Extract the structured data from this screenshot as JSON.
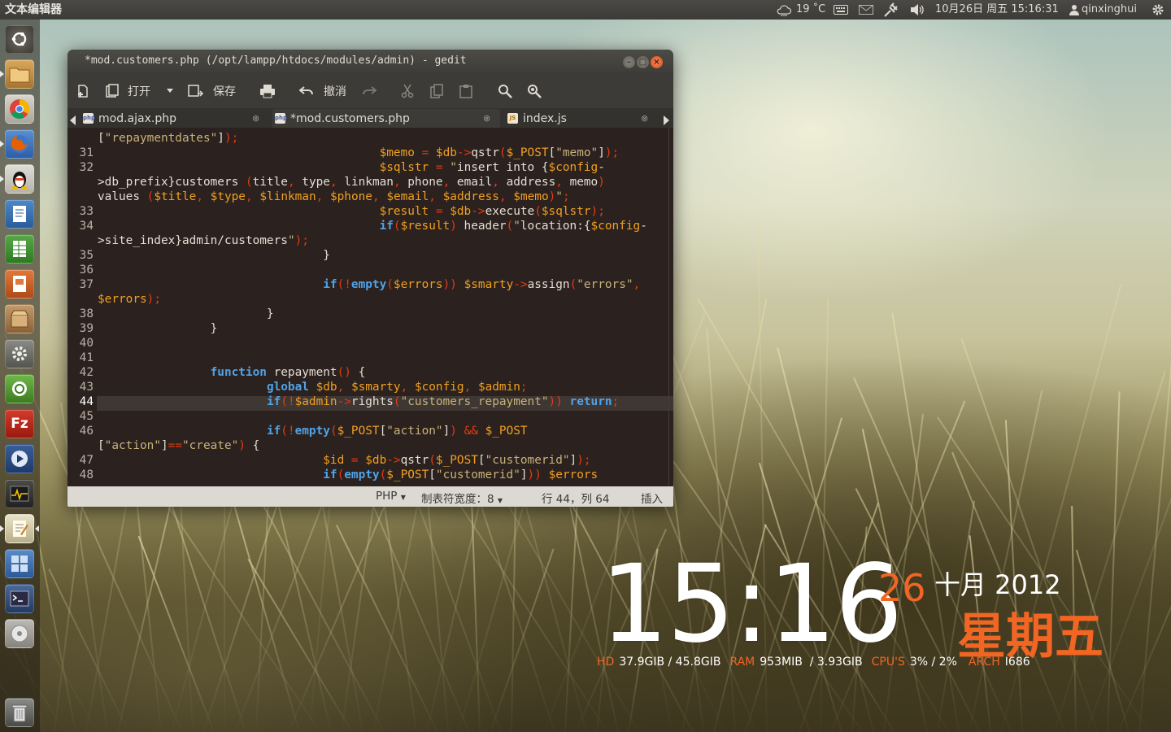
{
  "panel": {
    "app_title": "文本编辑器",
    "weather": "19 ˚C",
    "datetime": "10月26日 周五 15:16:31",
    "user": "qinxinghui"
  },
  "launcher": {
    "items": [
      "dash-home",
      "files",
      "chrome",
      "firefox",
      "qq",
      "writer",
      "calc",
      "impress",
      "archive",
      "system-settings",
      "ubuntu-one",
      "filezilla",
      "media-player",
      "system-monitor",
      "gedit",
      "workspace-switcher",
      "terminal",
      "cd-drive",
      "trash"
    ]
  },
  "window": {
    "title": "*mod.customers.php (/opt/lampp/htdocs/modules/admin) - gedit"
  },
  "toolbar": {
    "open_label": "打开",
    "save_label": "保存",
    "undo_label": "撤消"
  },
  "tabs": [
    {
      "label": "mod.ajax.php",
      "type": "php"
    },
    {
      "label": "*mod.customers.php",
      "type": "php"
    },
    {
      "label": "index.js",
      "type": "js"
    }
  ],
  "statusbar": {
    "language": "PHP",
    "tab_width": "制表符宽度：8",
    "position": "行 44，列 64",
    "mode": "插入"
  },
  "editor": {
    "current_line": "44",
    "lines": [
      {
        "n": "",
        "code": "[\"repaymentdates\"]);"
      },
      {
        "n": "31",
        "code": "                                        $memo = $db->qstr($_POST[\"memo\"]);"
      },
      {
        "n": "32",
        "code": "                                        $sqlstr = \"insert into {$config-"
      },
      {
        "n": "",
        "code": ">db_prefix}customers (title, type, linkman, phone, email, address, memo)"
      },
      {
        "n": "",
        "code": "values ($title, $type, $linkman, $phone, $email, $address, $memo)\";"
      },
      {
        "n": "33",
        "code": "                                        $result = $db->execute($sqlstr);"
      },
      {
        "n": "34",
        "code": "                                        if($result) header(\"location:{$config-"
      },
      {
        "n": "",
        "code": ">site_index}admin/customers\");"
      },
      {
        "n": "35",
        "code": "                                }"
      },
      {
        "n": "36",
        "code": ""
      },
      {
        "n": "37",
        "code": "                                if(!empty($errors)) $smarty->assign(\"errors\","
      },
      {
        "n": "",
        "code": "$errors);"
      },
      {
        "n": "38",
        "code": "                        }"
      },
      {
        "n": "39",
        "code": "                }"
      },
      {
        "n": "40",
        "code": ""
      },
      {
        "n": "41",
        "code": ""
      },
      {
        "n": "42",
        "code": "                function repayment() {"
      },
      {
        "n": "43",
        "code": "                        global $db, $smarty, $config, $admin;"
      },
      {
        "n": "44",
        "code": "                        if(!$admin->rights(\"customers_repayment\")) return;"
      },
      {
        "n": "45",
        "code": ""
      },
      {
        "n": "46",
        "code": "                        if(!empty($_POST[\"action\"]) && $_POST"
      },
      {
        "n": "",
        "code": "[\"action\"]==\"create\") {"
      },
      {
        "n": "47",
        "code": "                                $id = $db->qstr($_POST[\"customerid\"]);"
      },
      {
        "n": "48",
        "code": "                                if(empty($_POST[\"customerid\"])) $errors"
      }
    ]
  },
  "clock": {
    "time": "15:16",
    "day": "26",
    "month_year": "十月 2012",
    "weekday": "星期五"
  },
  "stats": {
    "hd_label": "HD",
    "hd_value": "37.9GIB / 45.8GIB",
    "ram_label": "RAM",
    "ram_value": "953MIB  / 3.93GIB",
    "cpu_label": "CPU'S",
    "cpu_value": "3% / 2%",
    "arch_label": "ARCH",
    "arch_value": "I686"
  },
  "colors": {
    "accent_orange": "#f26522",
    "panel_bg": "#3c3b37",
    "editor_bg": "#2b211e"
  }
}
